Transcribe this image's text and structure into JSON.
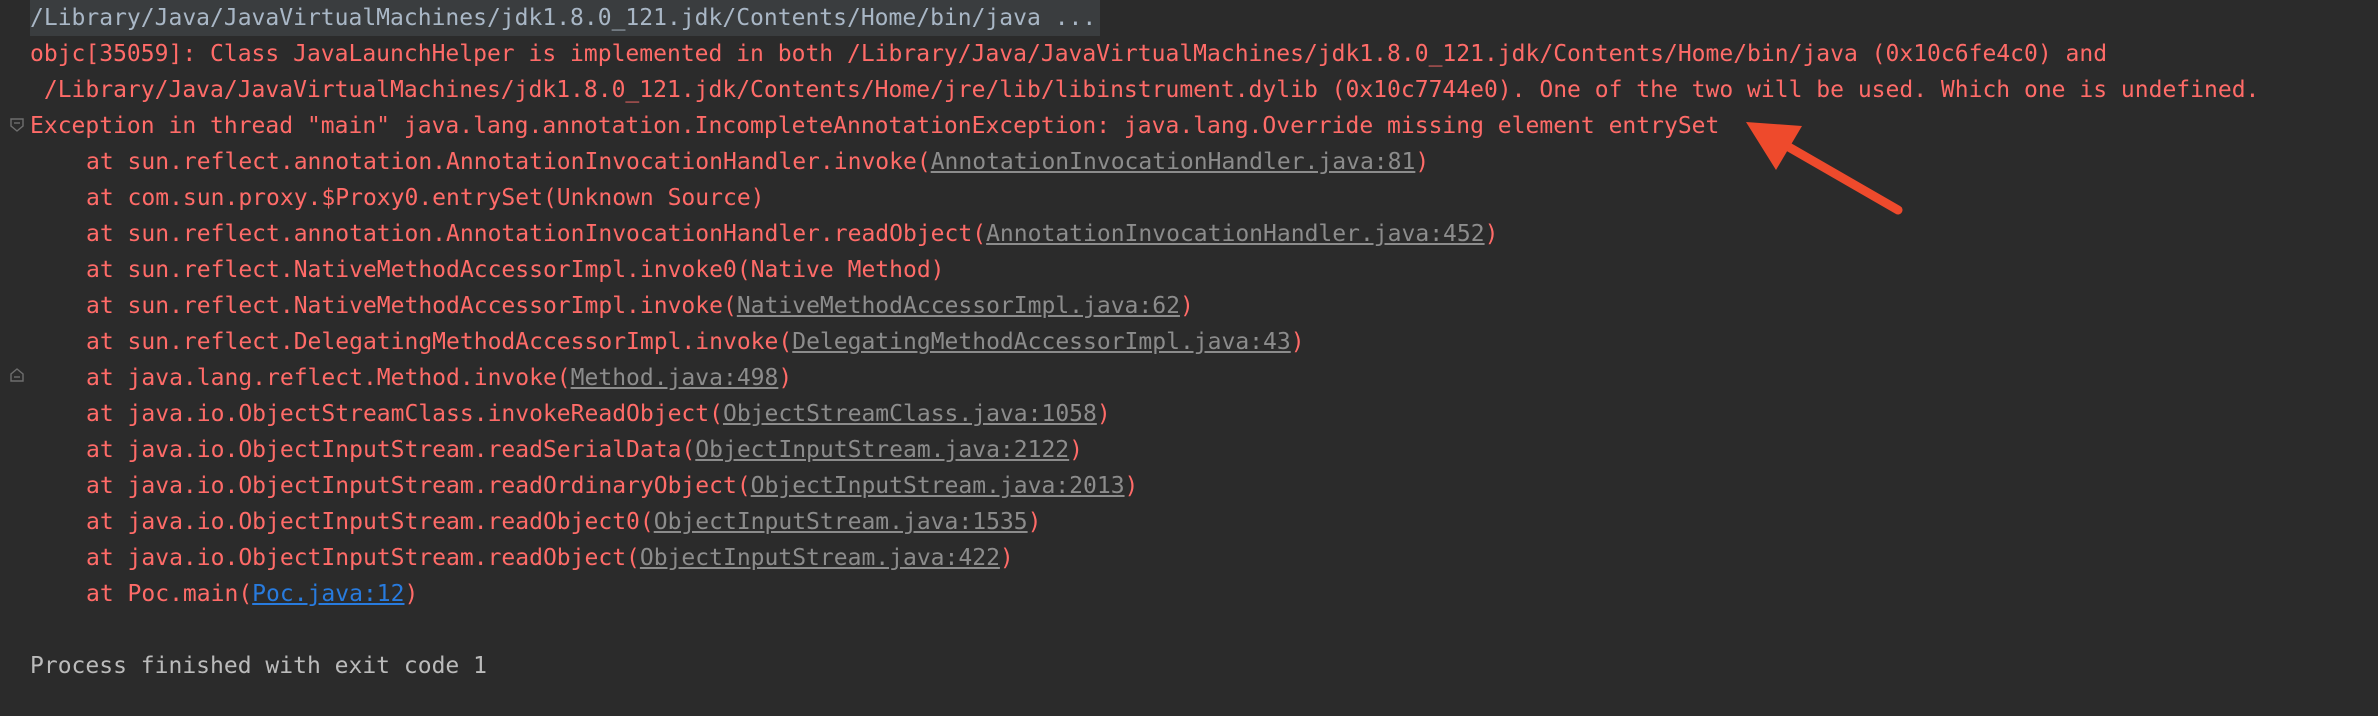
{
  "console": {
    "command": "/Library/Java/JavaVirtualMachines/jdk1.8.0_121.jdk/Contents/Home/bin/java ...",
    "warning_line1": "objc[35059]: Class JavaLaunchHelper is implemented in both /Library/Java/JavaVirtualMachines/jdk1.8.0_121.jdk/Contents/Home/bin/java (0x10c6fe4c0) and",
    "warning_line2": " /Library/Java/JavaVirtualMachines/jdk1.8.0_121.jdk/Contents/Home/jre/lib/libinstrument.dylib (0x10c7744e0). One of the two will be used. Which one is undefined.",
    "exception": "Exception in thread \"main\" java.lang.annotation.IncompleteAnnotationException: java.lang.Override missing element entrySet",
    "stack": [
      {
        "text": "at sun.reflect.annotation.AnnotationInvocationHandler.invoke(",
        "link": "AnnotationInvocationHandler.java:81",
        "close": ")"
      },
      {
        "text": "at com.sun.proxy.$Proxy0.entrySet(Unknown Source)",
        "link": "",
        "close": ""
      },
      {
        "text": "at sun.reflect.annotation.AnnotationInvocationHandler.readObject(",
        "link": "AnnotationInvocationHandler.java:452",
        "close": ")"
      },
      {
        "text": "at sun.reflect.NativeMethodAccessorImpl.invoke0(Native Method)",
        "link": "",
        "close": ""
      },
      {
        "text": "at sun.reflect.NativeMethodAccessorImpl.invoke(",
        "link": "NativeMethodAccessorImpl.java:62",
        "close": ")"
      },
      {
        "text": "at sun.reflect.DelegatingMethodAccessorImpl.invoke(",
        "link": "DelegatingMethodAccessorImpl.java:43",
        "close": ")"
      },
      {
        "text": "at java.lang.reflect.Method.invoke(",
        "link": "Method.java:498",
        "close": ")"
      },
      {
        "text": "at java.io.ObjectStreamClass.invokeReadObject(",
        "link": "ObjectStreamClass.java:1058",
        "close": ")"
      },
      {
        "text": "at java.io.ObjectInputStream.readSerialData(",
        "link": "ObjectInputStream.java:2122",
        "close": ")"
      },
      {
        "text": "at java.io.ObjectInputStream.readOrdinaryObject(",
        "link": "ObjectInputStream.java:2013",
        "close": ")"
      },
      {
        "text": "at java.io.ObjectInputStream.readObject0(",
        "link": "ObjectInputStream.java:1535",
        "close": ")"
      },
      {
        "text": "at java.io.ObjectInputStream.readObject(",
        "link": "ObjectInputStream.java:422",
        "close": ")"
      },
      {
        "text": "at Poc.main(",
        "link": "Poc.java:12",
        "close": ")"
      }
    ],
    "exit_message": "Process finished with exit code 1"
  },
  "colors": {
    "background": "#2b2b2b",
    "error": "#ff6b68",
    "library_link": "#8c8c8c",
    "user_link": "#287bde",
    "normal_text": "#bbbbbb",
    "annotation_arrow": "#ee4a2c"
  },
  "icons": {
    "fold_start": "fold-open-icon",
    "fold_end": "fold-close-icon",
    "annotation": "red-arrow-icon"
  }
}
